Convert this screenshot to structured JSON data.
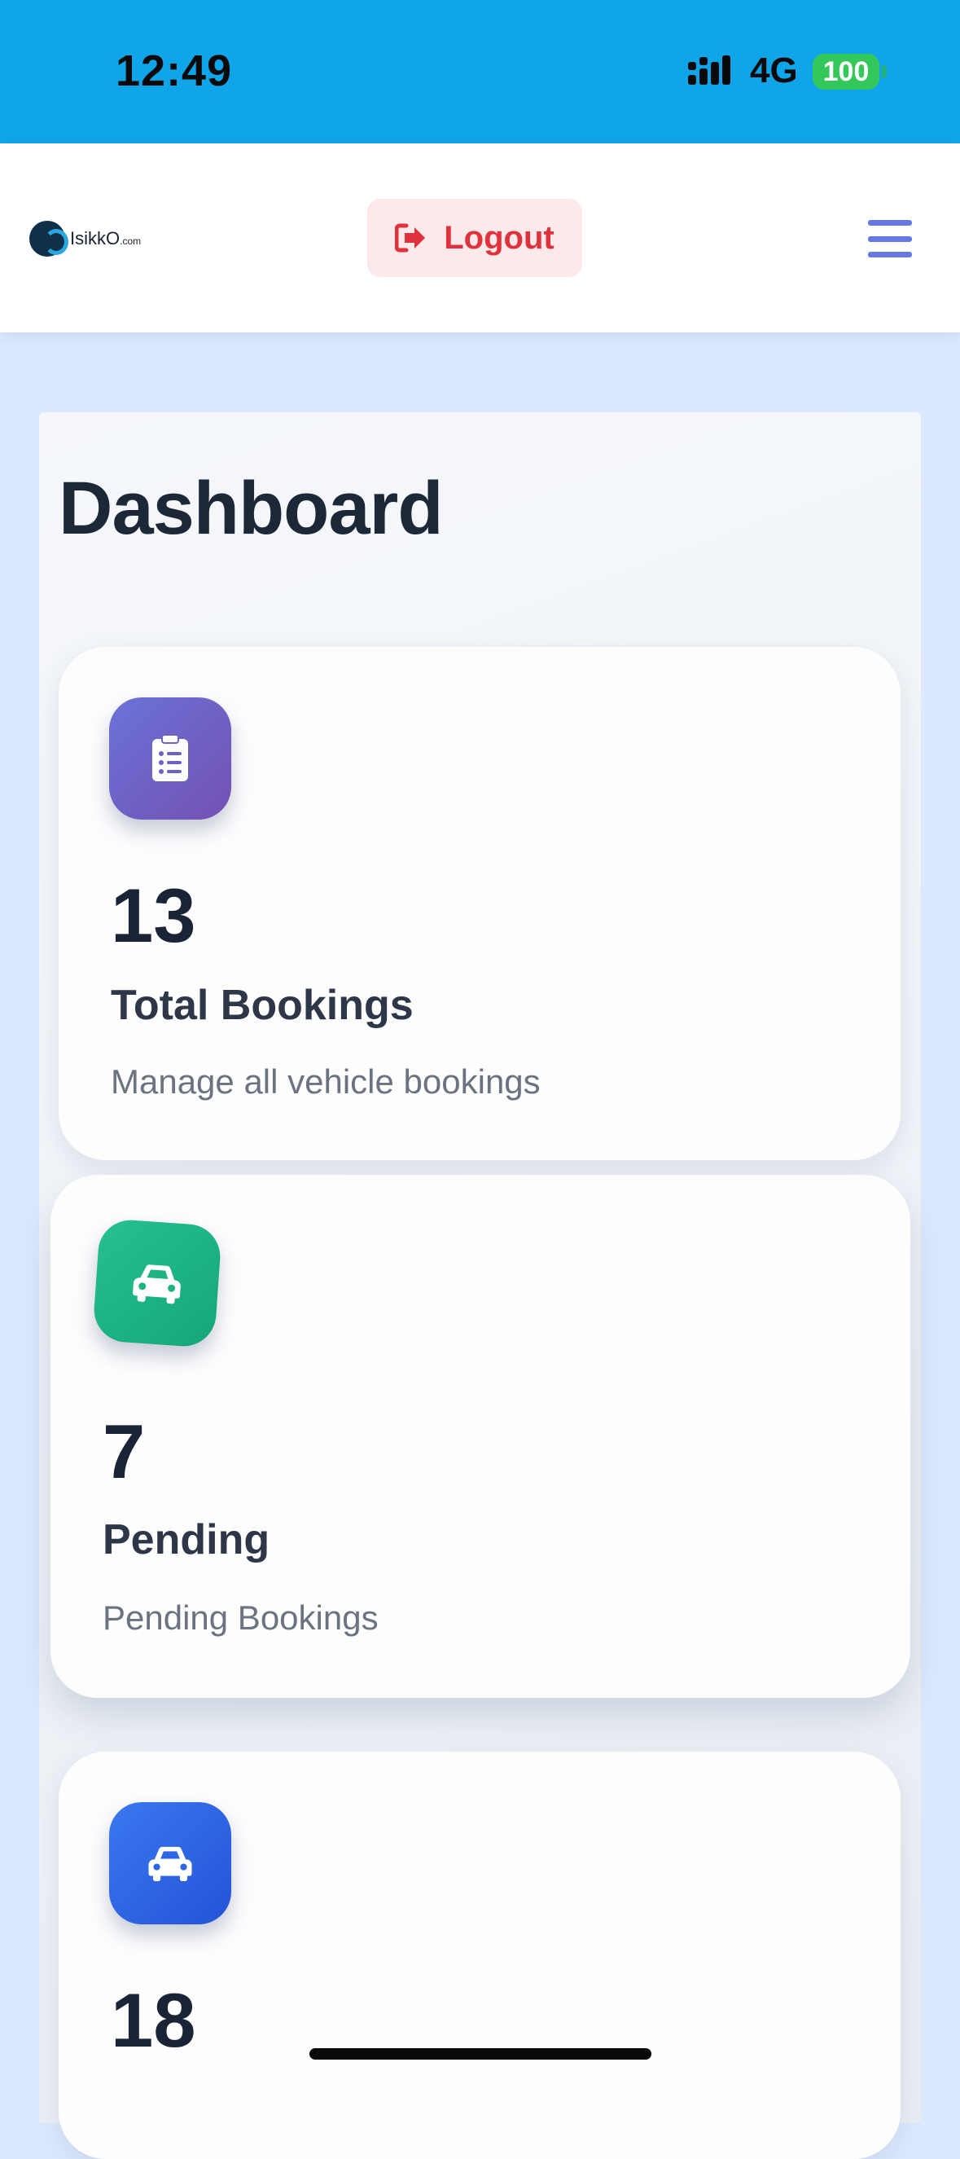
{
  "status_bar": {
    "time": "12:49",
    "network": "4G",
    "battery": "100"
  },
  "header": {
    "logo_text": "IsikkO",
    "logo_suffix": ".com",
    "logout_label": "Logout"
  },
  "page": {
    "title": "Dashboard"
  },
  "cards": [
    {
      "icon": "clipboard-list-icon",
      "value": "13",
      "label": "Total Bookings",
      "description": "Manage all vehicle bookings",
      "color": "#6b73d8"
    },
    {
      "icon": "car-icon",
      "value": "7",
      "label": "Pending",
      "description": "Pending Bookings",
      "color": "#27c08f"
    },
    {
      "icon": "car-icon",
      "value": "18",
      "color": "#3a78ef"
    }
  ],
  "colors": {
    "status_bar": "#10a5e8",
    "logout_text": "#e0313e",
    "logout_bg": "#fde8ea",
    "menu": "#6679e3",
    "background": "#dce8fd"
  }
}
